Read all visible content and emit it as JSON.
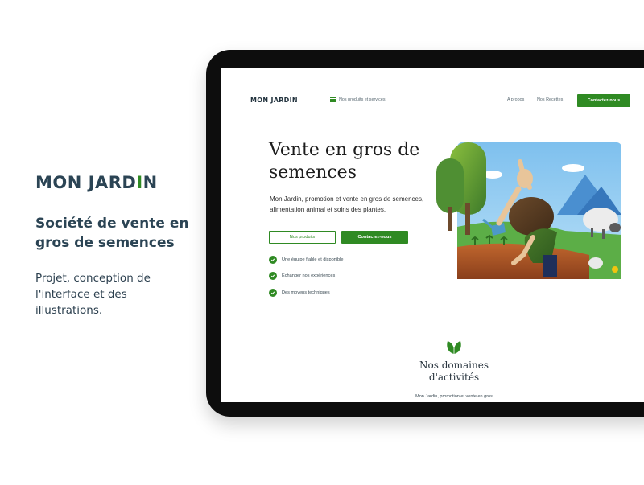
{
  "presentation": {
    "logo_prefix": "MON JARD",
    "logo_accent": "I",
    "logo_suffix": "N",
    "subtitle": "Société de vente en gros de semences",
    "description": "Projet, conception de l'interface et des illustrations."
  },
  "site": {
    "logo": "MON JARDIN",
    "menu_label": "Nos produits et services",
    "nav": {
      "apropos": "A propos",
      "recettes": "Nos Recettes",
      "contact": "Contactez-nous"
    },
    "hero": {
      "title": "Vente en gros de semences",
      "description": "Mon Jardin, promotion et vente en gros de semences, alimentation animal et soins des plantes.",
      "btn_products": "Nos produits",
      "btn_contact": "Contactez-nous",
      "features": [
        "Une équipe fiable et disponible",
        "Échanger nos expériences",
        "Des moyens techniques"
      ]
    },
    "section": {
      "title": "Nos domaines d'activités",
      "description": "Mon Jardin, promotion et vente en gros"
    }
  },
  "colors": {
    "accent": "#2f8a23",
    "text_dark": "#2b4454",
    "sky": "#8ac5ef"
  },
  "icons": [
    "hamburger-icon",
    "check-icon",
    "leaf-icon"
  ]
}
